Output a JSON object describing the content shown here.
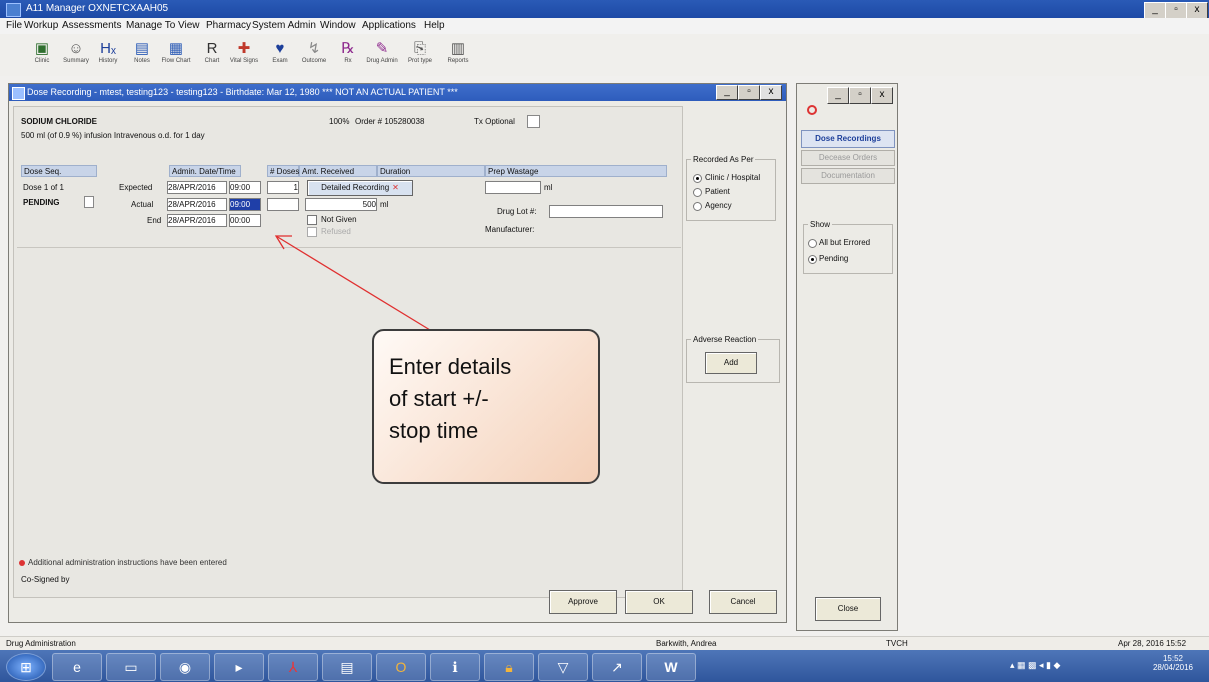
{
  "window": {
    "title": "A11 Manager OXNETCXAAH05",
    "min": "_",
    "max": "▫",
    "close": "x"
  },
  "menu": [
    "File",
    "Workup",
    "Assessments",
    "Manage To",
    "View",
    "Pharmacy",
    "System Admin",
    "Window",
    "Applications",
    "Help"
  ],
  "toolbar": [
    {
      "label": "Clinic",
      "icon": "clinic-icon",
      "glyph": "▣"
    },
    {
      "label": "Summary",
      "icon": "summary-icon",
      "glyph": "☺"
    },
    {
      "label": "History",
      "icon": "history-icon",
      "glyph": "Hₓ"
    },
    {
      "label": "Notes",
      "icon": "notes-icon",
      "glyph": "▤"
    },
    {
      "label": "Flow Chart",
      "icon": "flow-chart-icon",
      "glyph": "▦"
    },
    {
      "label": "Chart",
      "icon": "chart-icon",
      "glyph": "R"
    },
    {
      "label": "Vital Signs",
      "icon": "vital-signs-icon",
      "glyph": "✚"
    },
    {
      "label": "Exam",
      "icon": "exam-icon",
      "glyph": "♥"
    },
    {
      "label": "Outcome",
      "icon": "outcome-icon",
      "glyph": "↯"
    },
    {
      "label": "Rx",
      "icon": "rx-icon",
      "glyph": "℞"
    },
    {
      "label": "Drug Admin",
      "icon": "drug-admin-icon",
      "glyph": "✎"
    },
    {
      "label": "Prot type",
      "icon": "prot-type-icon",
      "glyph": "⎘"
    },
    {
      "label": "Reports",
      "icon": "reports-icon",
      "glyph": "▥"
    }
  ],
  "dialog": {
    "title": "Dose Recording - mtest, testing123 - testing123 - Birthdate: Mar 12, 1980 *** NOT AN ACTUAL PATIENT ***",
    "drug": "SODIUM CHLORIDE",
    "instructions": "500 ml (of 0.9 %) infusion Intravenous o.d. for 1 day",
    "percent": "100%",
    "order": "Order # 105280038",
    "tx": "Tx Optional",
    "headers": {
      "dose_seq": "Dose Seq.",
      "admin": "Admin. Date/Time",
      "doses": "# Doses",
      "amt": "Amt. Received",
      "duration": "Duration",
      "prep": "Prep Wastage"
    },
    "dose_label": "Dose 1 of 1",
    "status": "PENDING",
    "expected_label": "Expected",
    "actual_label": "Actual",
    "end_label": "End",
    "expected_date": "28/APR/2016",
    "expected_time": "09:00",
    "actual_date": "28/APR/2016",
    "actual_time": "09:00",
    "end_date": "28/APR/2016",
    "end_time": "00:00",
    "doses_expected": "1",
    "amount": "500",
    "amount_unit": "ml",
    "prep_unit": "ml",
    "detailed_recording": "Detailed Recording",
    "not_given": "Not Given",
    "refused": "Refused",
    "drug_lot": "Drug Lot #:",
    "manufacturer": "Manufacturer:",
    "recorded_as_per": "Recorded As Per",
    "rec_options": [
      "Clinic / Hospital",
      "Patient",
      "Agency"
    ],
    "adverse_reaction": "Adverse Reaction",
    "add": "Add",
    "footnote": "Additional administration instructions have been entered",
    "cosigned": "Co-Signed by",
    "approve": "Approve",
    "ok": "OK",
    "cancel": "Cancel"
  },
  "side": {
    "tabs": [
      "Dose Recordings",
      "Decease Orders",
      "Documentation"
    ],
    "show": "Show",
    "show_options": [
      "All but Errored",
      "Pending"
    ],
    "close": "Close"
  },
  "callout": "Enter details\nof start +/-\nstop time",
  "statusbar": {
    "left": "Drug Administration",
    "user": "Barkwith, Andrea",
    "site": "TVCH",
    "datetime": "Apr 28, 2016 15:52"
  },
  "clock": {
    "time": "15:52",
    "date": "28/04/2016"
  },
  "colors": {
    "titlebar": "#1d4aa6",
    "header_blue": "#c8d4e8",
    "arrow": "#e03030",
    "callout_fill": "#f4d0b8"
  }
}
